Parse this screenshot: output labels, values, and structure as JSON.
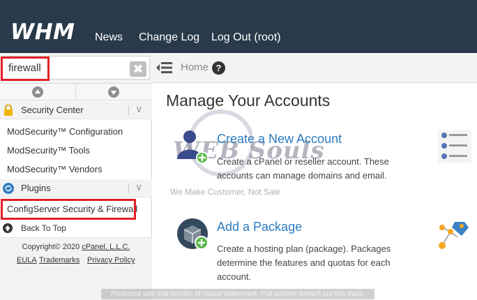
{
  "app": {
    "logo_text": "WHM"
  },
  "topnav": {
    "items": [
      "News",
      "Change Log",
      "Log Out (root)"
    ]
  },
  "sidebar": {
    "search": {
      "value": "firewall"
    },
    "categories": [
      {
        "label": "Security Center",
        "items": [
          "ModSecurity™ Configuration",
          "ModSecurity™ Tools",
          "ModSecurity™ Vendors"
        ]
      },
      {
        "label": "Plugins",
        "items": [
          "ConfigServer Security & Firewall"
        ]
      }
    ],
    "back_to_top": "Back To Top",
    "footer": {
      "copyright_prefix": "Copyright© 2020",
      "copyright_link": "cPanel, L.L.C.",
      "links": [
        "EULA",
        "Trademarks",
        "Privacy Policy"
      ]
    }
  },
  "breadcrumb": {
    "home": "Home"
  },
  "main": {
    "title": "Manage Your Accounts",
    "cards": [
      {
        "title": "Create a New Account",
        "description": "Create a cPanel or reseller account. These accounts can manage domains and email."
      },
      {
        "title": "Add a Package",
        "description": "Create a hosting plan (package). Packages determine the features and quotas for each account."
      }
    ]
  },
  "watermarks": {
    "logo": "WEB Souls",
    "tagline": "We Make Customer, Not Sale",
    "notice": "Protected with trial version of Visual Watermark. Full version doesn't put this mark."
  },
  "colors": {
    "topbar": "#293a4a",
    "link": "#2b7bbf",
    "highlight": "#e32028"
  }
}
